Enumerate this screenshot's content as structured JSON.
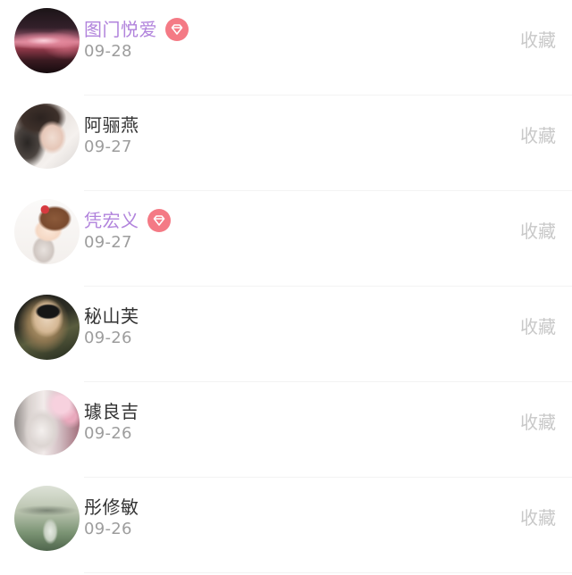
{
  "items": [
    {
      "name": "图门悦爱",
      "date": "09-28",
      "action": "收藏",
      "vip": true,
      "avatar": "night-city-photo"
    },
    {
      "name": "阿骊燕",
      "date": "09-27",
      "action": "收藏",
      "vip": false,
      "avatar": "person-portrait-photo"
    },
    {
      "name": "凭宏义",
      "date": "09-27",
      "action": "收藏",
      "vip": true,
      "avatar": "cartoon-girl-illustration"
    },
    {
      "name": "秘山芙",
      "date": "09-26",
      "action": "收藏",
      "vip": false,
      "avatar": "sunglasses-portrait-photo"
    },
    {
      "name": "璩良吉",
      "date": "09-26",
      "action": "收藏",
      "vip": false,
      "avatar": "mug-and-flowers-photo"
    },
    {
      "name": "彤修敏",
      "date": "09-26",
      "action": "收藏",
      "vip": false,
      "avatar": "green-landscape-photo"
    }
  ],
  "badge_icon": "diamond-icon",
  "colors": {
    "vip_name": "#b183dc",
    "name": "#333333",
    "date": "#9d9d9d",
    "action": "#c8c8c8",
    "badge": "#f47a85",
    "divider": "#f3f3f3"
  }
}
